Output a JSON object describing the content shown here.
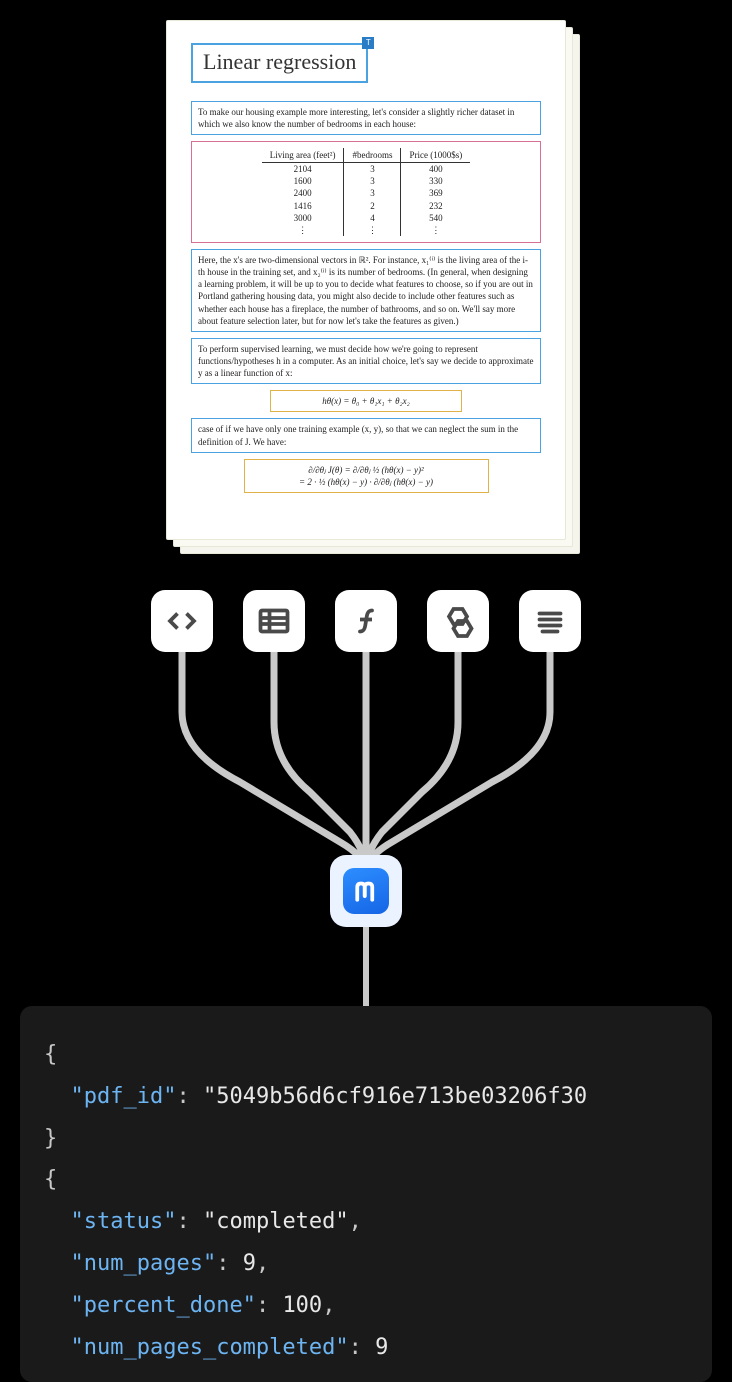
{
  "document": {
    "title": "Linear regression",
    "title_tag": "T",
    "intro": "To make our housing example more interesting, let's consider a slightly richer dataset in which we also know the number of bedrooms in each house:",
    "table": {
      "headers": [
        "Living area (feet²)",
        "#bedrooms",
        "Price (1000$s)"
      ],
      "rows": [
        [
          "2104",
          "3",
          "400"
        ],
        [
          "1600",
          "3",
          "330"
        ],
        [
          "2400",
          "3",
          "369"
        ],
        [
          "1416",
          "2",
          "232"
        ],
        [
          "3000",
          "4",
          "540"
        ],
        [
          "⋮",
          "⋮",
          "⋮"
        ]
      ]
    },
    "para2": "Here, the x's are two-dimensional vectors in ℝ². For instance, x₁⁽ⁱ⁾ is the living area of the i-th house in the training set, and x₂⁽ⁱ⁾ is its number of bedrooms. (In general, when designing a learning problem, it will be up to you to decide what features to choose, so if you are out in Portland gathering housing data, you might also decide to include other features such as whether each house has a fireplace, the number of bathrooms, and so on. We'll say more about feature selection later, but for now let's take the features as given.)",
    "para3": "To perform supervised learning, we must decide how we're going to represent functions/hypotheses h in a computer. As an initial choice, let's say we decide to approximate y as a linear function of x:",
    "formula1": "hθ(x) = θ₀ + θ₁x₁ + θ₂x₂",
    "para4": "case of if we have only one training example (x, y), so that we can neglect the sum in the definition of J. We have:",
    "formula2a": "∂/∂θⱼ J(θ)  =  ∂/∂θⱼ ½ (hθ(x) − y)²",
    "formula2b": "=  2 · ½ (hθ(x) − y) · ∂/∂θⱼ (hθ(x) − y)"
  },
  "icons": [
    {
      "name": "code-icon"
    },
    {
      "name": "table-icon"
    },
    {
      "name": "function-icon"
    },
    {
      "name": "molecule-icon"
    },
    {
      "name": "text-icon"
    }
  ],
  "logo": {
    "letter": "ᱬ"
  },
  "code": {
    "lines": [
      {
        "type": "brace",
        "text": "{"
      },
      {
        "type": "kv",
        "indent": 1,
        "key": "pdf_id",
        "value": "\"5049b56d6cf916e713be03206f30",
        "vtype": "string"
      },
      {
        "type": "brace",
        "text": "}"
      },
      {
        "type": "brace",
        "text": "{"
      },
      {
        "type": "kv",
        "indent": 1,
        "key": "status",
        "value": "\"completed\"",
        "vtype": "string",
        "comma": true
      },
      {
        "type": "kv",
        "indent": 1,
        "key": "num_pages",
        "value": "9",
        "vtype": "number",
        "comma": true
      },
      {
        "type": "kv",
        "indent": 1,
        "key": "percent_done",
        "value": "100",
        "vtype": "number",
        "comma": true
      },
      {
        "type": "kv",
        "indent": 1,
        "key": "num_pages_completed",
        "value": "9",
        "vtype": "number"
      }
    ]
  }
}
